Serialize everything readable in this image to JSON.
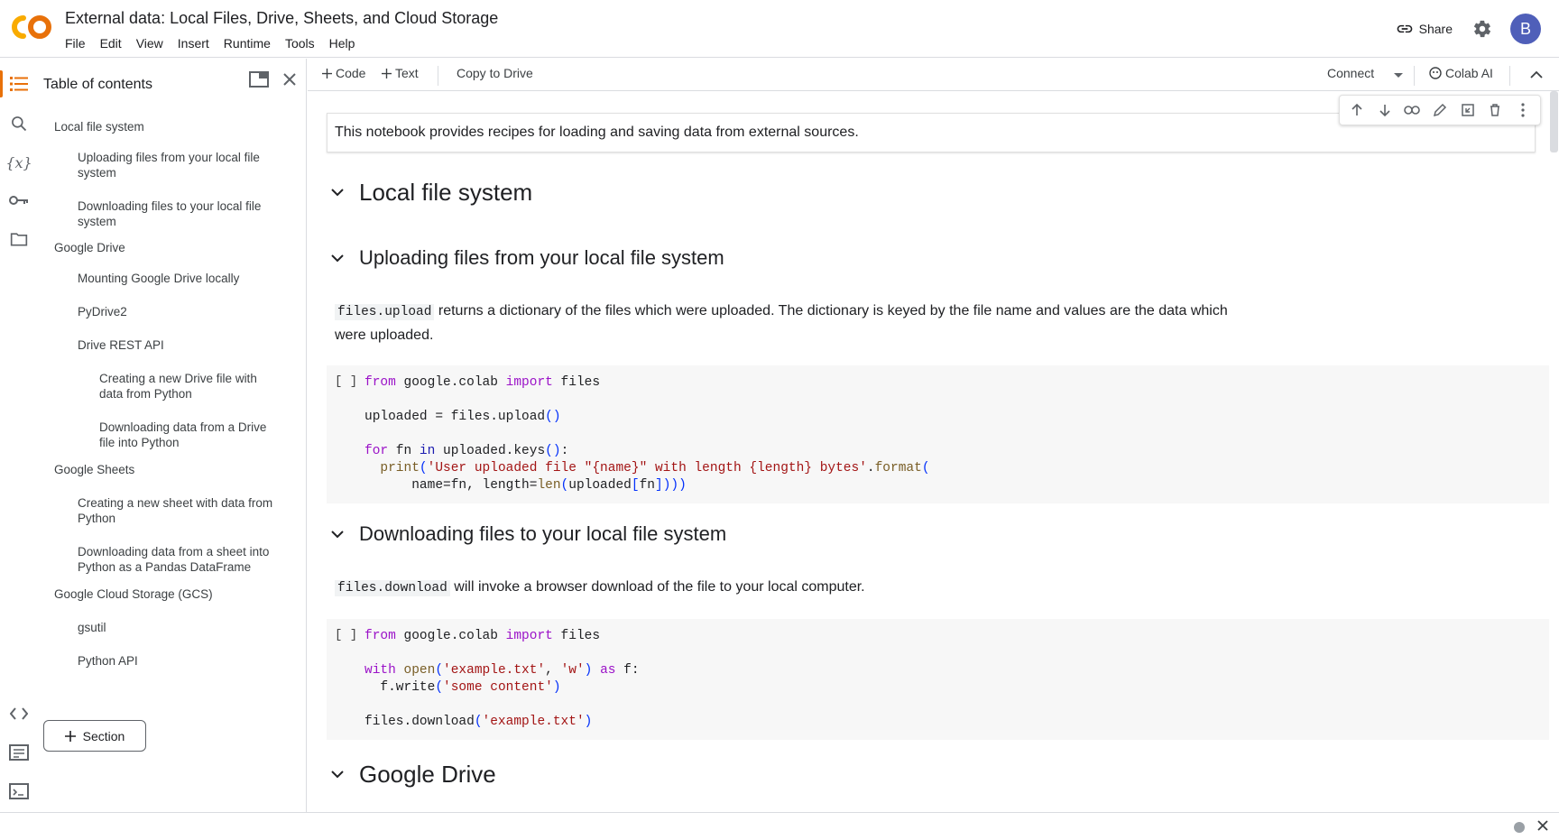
{
  "app": {
    "title": "External data: Local Files, Drive, Sheets, and Cloud Storage",
    "logo_text": "CO"
  },
  "menu": [
    "File",
    "Edit",
    "View",
    "Insert",
    "Runtime",
    "Tools",
    "Help"
  ],
  "header": {
    "share_label": "Share",
    "avatar_letter": "B"
  },
  "toolbar": {
    "code_label": "Code",
    "text_label": "Text",
    "copy_label": "Copy to Drive",
    "connect_label": "Connect",
    "ai_label": "Colab AI"
  },
  "toc": {
    "title": "Table of contents",
    "items": [
      {
        "label": "Local file system",
        "level": 1
      },
      {
        "label": "Uploading files from your local file system",
        "level": 2
      },
      {
        "label": "Downloading files to your local file system",
        "level": 2
      },
      {
        "label": "Google Drive",
        "level": 1
      },
      {
        "label": "Mounting Google Drive locally",
        "level": 2
      },
      {
        "label": "PyDrive2",
        "level": 2
      },
      {
        "label": "Drive REST API",
        "level": 2
      },
      {
        "label": "Creating a new Drive file with data from Python",
        "level": 3
      },
      {
        "label": "Downloading data from a Drive file into Python",
        "level": 3
      },
      {
        "label": "Google Sheets",
        "level": 1
      },
      {
        "label": "Creating a new sheet with data from Python",
        "level": 2
      },
      {
        "label": "Downloading data from a sheet into Python as a Pandas DataFrame",
        "level": 2
      },
      {
        "label": "Google Cloud Storage (GCS)",
        "level": 1
      },
      {
        "label": "gsutil",
        "level": 2
      },
      {
        "label": "Python API",
        "level": 2
      }
    ],
    "section_button": "Section"
  },
  "notebook": {
    "intro": "This notebook provides recipes for loading and saving data from external sources.",
    "h_local": "Local file system",
    "h_upload": "Uploading files from your local file system",
    "upload_code_term": "files.upload",
    "upload_desc": "returns a dictionary of the files which were uploaded. The dictionary is keyed by the file name and values are the data which were uploaded.",
    "h_download": "Downloading files to your local file system",
    "download_code_term": "files.download",
    "download_desc": "will invoke a browser download of the file to your local computer.",
    "h_drive": "Google Drive",
    "run_indicator": "[ ]"
  },
  "colors": {
    "accent": "#e8710a",
    "avatar_bg": "#4f5fb9",
    "keyword": "#9b13c8",
    "string": "#a31515"
  }
}
